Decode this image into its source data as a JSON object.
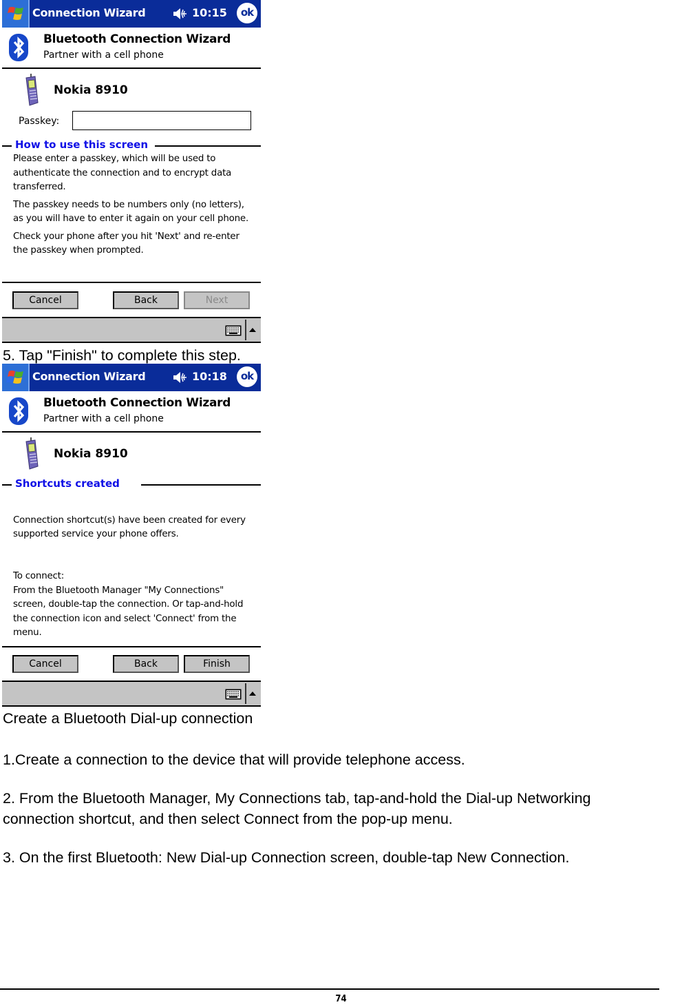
{
  "screens": [
    {
      "titlebar": {
        "title": "Connection Wizard",
        "time": "10:15",
        "ok_label": "ok"
      },
      "header": {
        "title": "Bluetooth Connection Wizard",
        "subtitle": "Partner with a cell phone"
      },
      "device_name": "Nokia 8910",
      "passkey": {
        "label": "Passkey:",
        "value": "",
        "placeholder": ""
      },
      "group_title": "How to use this screen",
      "paragraphs": [
        "Please enter a passkey, which will be used to authenticate the connection and to encrypt data transferred.",
        "The passkey needs to be numbers only (no letters), as you will have to enter it again on your cell phone.",
        "Check your phone after you hit 'Next' and re-enter the passkey when prompted."
      ],
      "buttons": {
        "cancel": "Cancel",
        "back": "Back",
        "next": "Next"
      }
    },
    {
      "titlebar": {
        "title": "Connection Wizard",
        "time": "10:18",
        "ok_label": "ok"
      },
      "header": {
        "title": "Bluetooth Connection Wizard",
        "subtitle": "Partner with a cell phone"
      },
      "device_name": "Nokia 8910",
      "group_title": "Shortcuts created",
      "paragraphs": [
        "Connection shortcut(s)  have been created for every supported service your phone offers.",
        "To connect:\nFrom the Bluetooth Manager \"My Connections\" screen, double-tap the connection. Or tap-and-hold the connection icon and select 'Connect' from the menu."
      ],
      "buttons": {
        "cancel": "Cancel",
        "back": "Back",
        "finish": "Finish"
      }
    }
  ],
  "document": {
    "step5": "5. Tap   \"Finish\" to complete this step.",
    "section_heading": "Create a Bluetooth Dial-up connection",
    "steps": [
      "1.Create a connection to the device that will provide telephone access.",
      "2. From the Bluetooth Manager, My Connections tab, tap-and-hold the Dial-up Networking",
      "connection shortcut, and then select Connect from the pop-up menu.",
      "3. On the first Bluetooth: New Dial-up Connection screen, double-tap New Connection."
    ],
    "page_number": "74"
  },
  "colors": {
    "titlebar": "#0a2c99",
    "start_button": "#2d6fd6",
    "group_title": "#1010e6",
    "button_face": "#c4c4c4"
  },
  "icons": {
    "start": "windows-flag-icon",
    "speaker": "speaker-icon",
    "bluetooth": "bluetooth-icon",
    "phone": "cell-phone-icon",
    "keyboard": "keyboard-icon",
    "sip_arrow": "triangle-up-icon"
  }
}
